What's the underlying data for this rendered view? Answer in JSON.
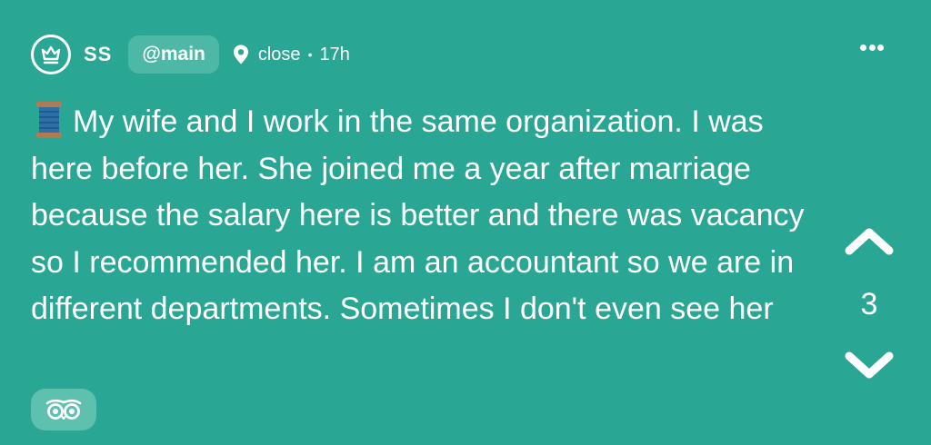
{
  "post": {
    "author": {
      "name": "SS",
      "avatar_icon": "crown-icon"
    },
    "channel": "@main",
    "location": "close",
    "separator": "•",
    "time": "17h",
    "text_emoji": "spool-of-thread-icon",
    "text": "My wife and I work in the same organization. I was here before her. She joined me a year after marriage because the salary here is better and there was vacancy so I recommended her. I am an accountant so we are in different departments. Sometimes I don't even see her",
    "votes": {
      "count": "3",
      "up_icon": "chevron-up-icon",
      "down_icon": "chevron-down-icon"
    },
    "more_icon": "more-options-icon",
    "bottom_icon": "owl-eyes-icon"
  },
  "colors": {
    "background": "#2aa794",
    "pill": "#4db8a6",
    "badge": "#5ec0af",
    "text": "#ffffff"
  }
}
